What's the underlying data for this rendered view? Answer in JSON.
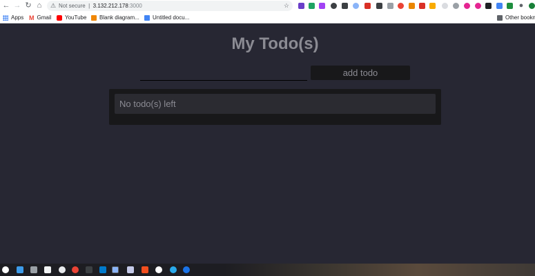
{
  "browser": {
    "security_label": "Not secure",
    "url_host": "3.132.212.178",
    "url_port": ":3000",
    "bookmarks": [
      {
        "label": "Apps"
      },
      {
        "label": "Gmail"
      },
      {
        "label": "YouTube"
      },
      {
        "label": "Blank diagram..."
      },
      {
        "label": "Untitled docu..."
      }
    ],
    "other_bookmarks": "Other bookma"
  },
  "app": {
    "title": "My Todo(s)",
    "input_value": "",
    "add_button": "add todo",
    "empty_message": "No todo(s) left"
  },
  "colors": {
    "background": "#272733",
    "panel": "#18181a",
    "text": "#8b8b93"
  }
}
